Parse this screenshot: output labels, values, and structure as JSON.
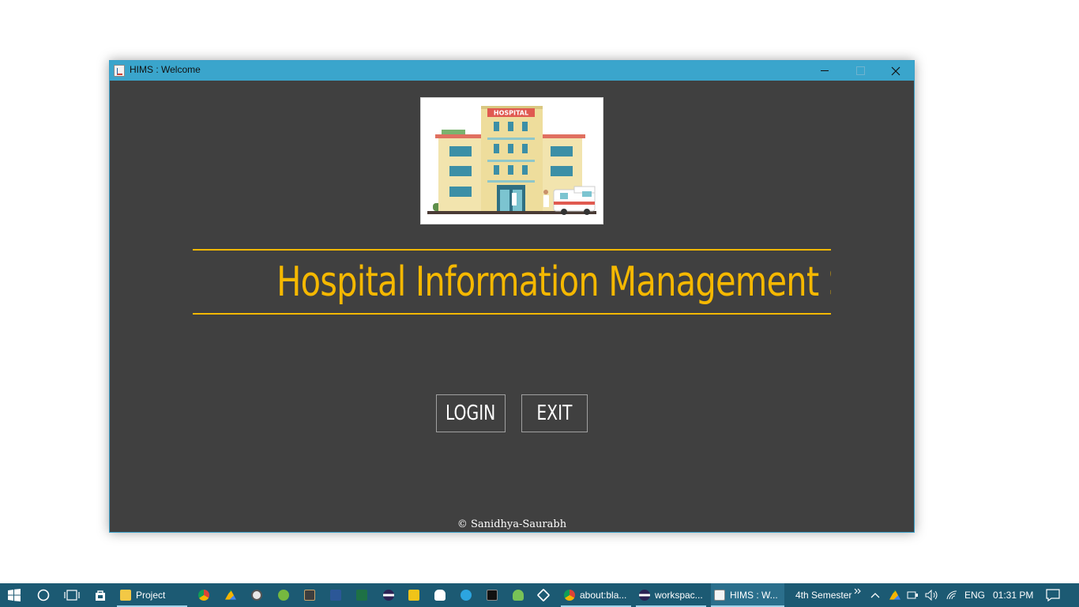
{
  "window": {
    "title": "HIMS : Welcome",
    "heading": "Hospital Information Management System",
    "login_label": "LOGIN",
    "exit_label": "EXIT",
    "footer": "© Sanidhya-Saurabh",
    "hospital_sign": "HOSPITAL",
    "colors": {
      "background": "#404040",
      "accent": "#f5b800",
      "titlebar": "#3aa5cc"
    }
  },
  "taskbar": {
    "tasks": [
      {
        "label": "Project",
        "icon": "file-explorer-icon"
      },
      {
        "label": "about:bla...",
        "icon": "chrome-icon"
      },
      {
        "label": "workspac...",
        "icon": "eclipse-icon"
      },
      {
        "label": "HIMS : W...",
        "icon": "java-icon",
        "active": true
      }
    ],
    "pinned_icons": [
      "chrome-icon",
      "google-drive-icon",
      "media-icon",
      "utorrent-icon",
      "notepad-icon",
      "word-icon",
      "excel-icon",
      "eclipse-icon",
      "folder-app-icon",
      "hand-icon",
      "telegram-icon",
      "terminal-icon",
      "android-studio-icon",
      "virtualbox-icon"
    ],
    "toolbar_label": "4th Semester",
    "language": "ENG",
    "time": "01:31 PM"
  }
}
